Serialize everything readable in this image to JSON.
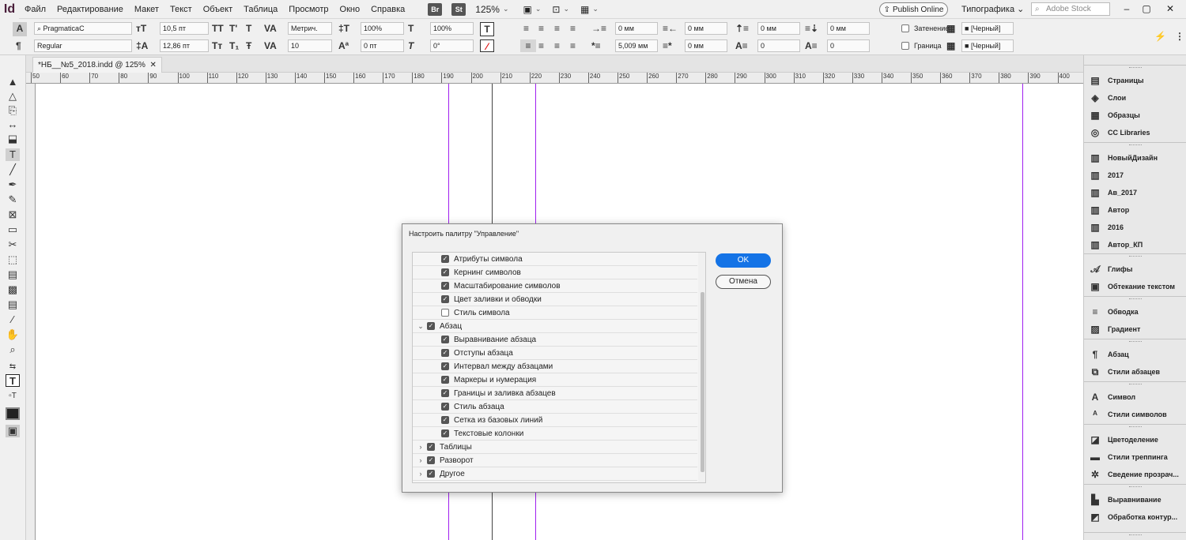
{
  "app": {
    "logo": "Id"
  },
  "menu": [
    "Файл",
    "Редактирование",
    "Макет",
    "Текст",
    "Объект",
    "Таблица",
    "Просмотр",
    "Окно",
    "Справка"
  ],
  "titlebar": {
    "br": "Br",
    "st": "St",
    "zoom": "125%",
    "publish": "Publish Online",
    "workspace": "Типографика",
    "search_placeholder": "Adobe Stock"
  },
  "control": {
    "font": "PragmaticaC",
    "style": "Regular",
    "size": "10,5 пт",
    "leading": "12,86 пт",
    "kerning": "Метрич.",
    "tracking": "10",
    "hscale": "100%",
    "vscale": "100%",
    "baseline": "0 пт",
    "skew": "0°",
    "indent_left": "0 мм",
    "indent_right": "0 мм",
    "first_line": "5,009 мм",
    "last_line": "0 мм",
    "space_before": "0 мм",
    "space_after": "0 мм",
    "dropcap_lines": "0",
    "dropcap_chars": "0",
    "shading_label": "Затенение",
    "border_label": "Граница",
    "swatch1": "[Черный]",
    "swatch2": "[Черный]"
  },
  "document": {
    "tab": "*НБ__№5_2018.indd @ 125%",
    "close": "✕"
  },
  "ruler": [
    "50",
    "60",
    "70",
    "80",
    "90",
    "100",
    "110",
    "120",
    "130",
    "140",
    "150",
    "160",
    "170",
    "180",
    "190",
    "200",
    "210",
    "220",
    "230",
    "240",
    "250",
    "260",
    "270",
    "280",
    "290",
    "300",
    "310",
    "320",
    "330",
    "340",
    "350",
    "360",
    "370",
    "380",
    "390",
    "400"
  ],
  "panels": [
    {
      "label": "Страницы",
      "icon": "pages-icon"
    },
    {
      "label": "Слои",
      "icon": "layers-icon"
    },
    {
      "label": "Образцы",
      "icon": "swatches-icon"
    },
    {
      "label": "CC Libraries",
      "icon": "cc-libraries-icon"
    },
    {
      "label": "НовыйДизайн",
      "icon": "library-icon"
    },
    {
      "label": "2017",
      "icon": "library-icon"
    },
    {
      "label": "Ав_2017",
      "icon": "library-icon"
    },
    {
      "label": "Автор",
      "icon": "library-icon"
    },
    {
      "label": "2016",
      "icon": "library-icon"
    },
    {
      "label": "Автор_КП",
      "icon": "library-icon"
    },
    {
      "label": "Глифы",
      "icon": "glyphs-icon"
    },
    {
      "label": "Обтекание текстом",
      "icon": "text-wrap-icon"
    },
    {
      "label": "Обводка",
      "icon": "stroke-icon"
    },
    {
      "label": "Градиент",
      "icon": "gradient-icon"
    },
    {
      "label": "Абзац",
      "icon": "paragraph-icon"
    },
    {
      "label": "Стили абзацев",
      "icon": "paragraph-styles-icon"
    },
    {
      "label": "Символ",
      "icon": "character-icon"
    },
    {
      "label": "Стили символов",
      "icon": "character-styles-icon"
    },
    {
      "label": "Цветоделение",
      "icon": "separations-icon"
    },
    {
      "label": "Стили треппинга",
      "icon": "trap-styles-icon"
    },
    {
      "label": "Сведение прозрач...",
      "icon": "flattener-icon"
    },
    {
      "label": "Выравнивание",
      "icon": "align-icon"
    },
    {
      "label": "Обработка контур...",
      "icon": "pathfinder-icon"
    }
  ],
  "dialog": {
    "title": "Настроить палитру \"Управление\"",
    "ok": "OK",
    "cancel": "Отмена",
    "rows": [
      {
        "label": "Атрибуты символа",
        "level": 1,
        "checked": true
      },
      {
        "label": "Кернинг символов",
        "level": 1,
        "checked": true
      },
      {
        "label": "Масштабирование символов",
        "level": 1,
        "checked": true
      },
      {
        "label": "Цвет заливки и обводки",
        "level": 1,
        "checked": true
      },
      {
        "label": "Стиль символа",
        "level": 1,
        "checked": false
      },
      {
        "label": "Абзац",
        "level": 0,
        "checked": true,
        "expanded": true
      },
      {
        "label": "Выравнивание абзаца",
        "level": 1,
        "checked": true
      },
      {
        "label": "Отступы абзаца",
        "level": 1,
        "checked": true
      },
      {
        "label": "Интервал между абзацами",
        "level": 1,
        "checked": true
      },
      {
        "label": "Маркеры и нумерация",
        "level": 1,
        "checked": true
      },
      {
        "label": "Границы и заливка абзацев",
        "level": 1,
        "checked": true
      },
      {
        "label": "Стиль абзаца",
        "level": 1,
        "checked": true
      },
      {
        "label": "Сетка из базовых линий",
        "level": 1,
        "checked": true
      },
      {
        "label": "Текстовые колонки",
        "level": 1,
        "checked": true
      },
      {
        "label": "Таблицы",
        "level": 0,
        "checked": true,
        "expanded": false
      },
      {
        "label": "Разворот",
        "level": 0,
        "checked": true,
        "expanded": false
      },
      {
        "label": "Другое",
        "level": 0,
        "checked": true,
        "expanded": false
      }
    ]
  },
  "colors": {
    "guide": "#a020f0",
    "accent": "#1473e6"
  }
}
